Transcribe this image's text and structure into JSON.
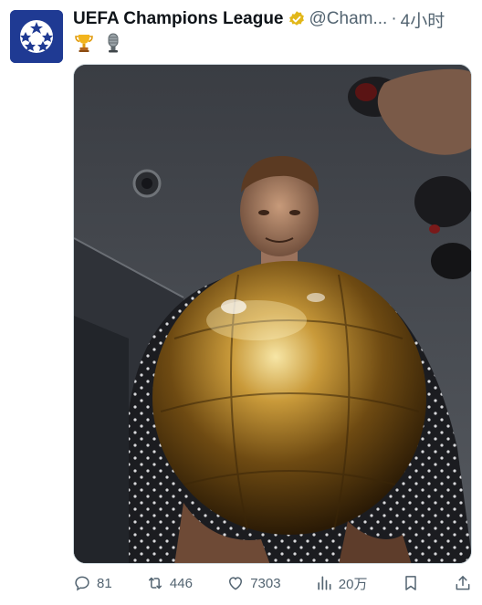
{
  "tweet": {
    "author_name": "UEFA Champions League",
    "handle": "@Cham...",
    "separator": "·",
    "time": "4小时",
    "emojis": [
      "trophy-emoji",
      "microphone-emoji"
    ],
    "colors": {
      "avatar_bg": "#1f3a93",
      "verified_badge": "#e2b719",
      "secondary_text": "#536471"
    }
  },
  "actions": {
    "replies": "81",
    "retweets": "446",
    "likes": "7303",
    "views": "20万"
  },
  "icons": {
    "avatar": "ucl-starball-logo",
    "verified": "gold-verified-badge-icon",
    "reply": "reply-icon",
    "retweet": "retweet-icon",
    "like": "heart-icon",
    "views": "views-bar-chart-icon",
    "bookmark": "bookmark-icon",
    "share": "share-icon"
  }
}
